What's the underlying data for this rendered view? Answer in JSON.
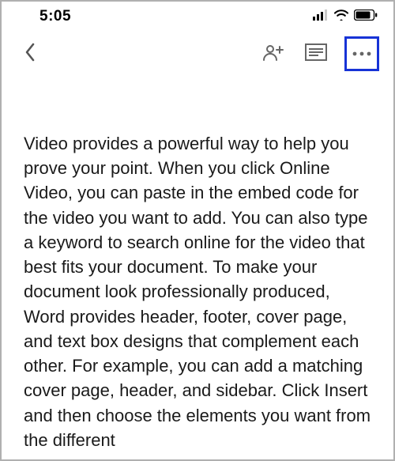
{
  "status_bar": {
    "time": "5:05"
  },
  "toolbar": {
    "back_label": "Back",
    "share_label": "Share",
    "list_label": "Outline",
    "more_label": "More"
  },
  "document": {
    "body_text": "Video provides a powerful way to help you prove your point. When you click Online Video, you can paste in the embed code for the video you want to add. You can also type a keyword to search online for the video that best fits your document. To make your document look professionally produced, Word provides header, footer, cover page, and text box designs that complement each other. For example, you can add a matching cover page, header, and sidebar. Click Insert and then choose the elements you want from the different"
  }
}
